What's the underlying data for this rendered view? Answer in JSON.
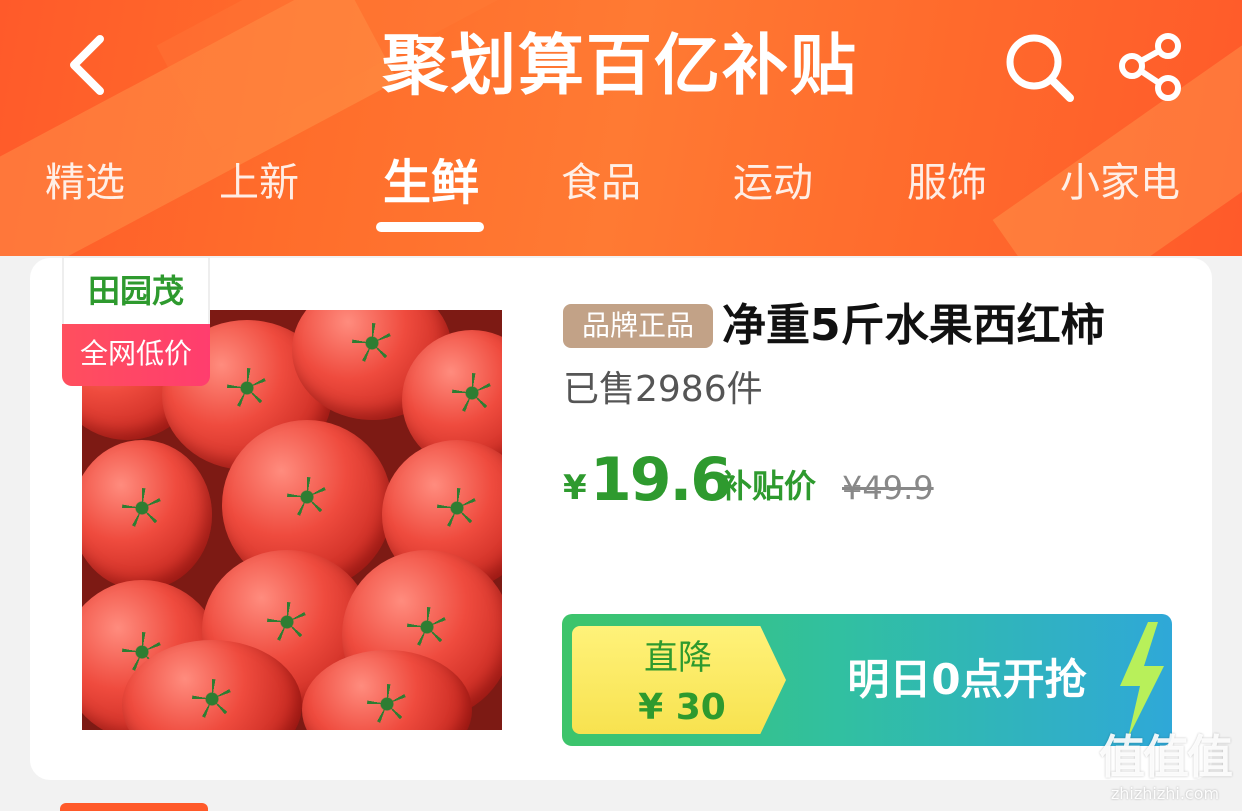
{
  "header": {
    "title": "聚划算百亿补贴",
    "tabs": [
      {
        "label": "精选"
      },
      {
        "label": "上新"
      },
      {
        "label": "生鲜"
      },
      {
        "label": "食品"
      },
      {
        "label": "运动"
      },
      {
        "label": "服饰"
      },
      {
        "label": "小家电"
      }
    ],
    "active_tab": "生鲜"
  },
  "product": {
    "brand_badge": "田园茂",
    "promo_badge": "全网低价",
    "authentic_tag": "品牌正品",
    "title": "净重5斤水果西红柿",
    "sold": "已售2986件",
    "currency": "¥",
    "price": "19.6",
    "price_label": "补贴价",
    "original_price": "¥49.9",
    "discount_title": "直降",
    "discount_amount": "¥ 30",
    "cta": "明日0点开抢"
  },
  "watermark": {
    "logo": "值值值",
    "site": "zhizhizhi.com"
  },
  "colors": {
    "header_orange": "#ff6a2c",
    "price_green": "#2e9a2e",
    "authentic_tag": "#c2a287",
    "promo_pink": "#ff4f5e"
  },
  "icons": [
    "back-icon",
    "search-icon",
    "share-icon",
    "lightning-icon"
  ]
}
